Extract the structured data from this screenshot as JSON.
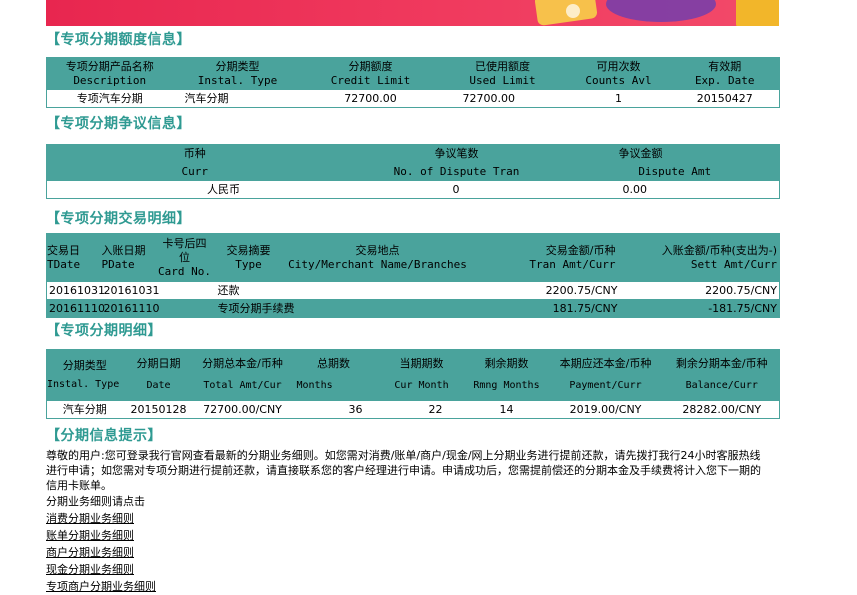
{
  "colors": {
    "teal": "#4aa39c",
    "title": "#2f9a92",
    "banner": "#e8264f"
  },
  "credit_info": {
    "title": "【专项分期额度信息】",
    "headers": [
      {
        "cn": "专项分期产品名称",
        "en": "Description"
      },
      {
        "cn": "分期类型",
        "en": "Instal. Type"
      },
      {
        "cn": "分期额度",
        "en": "Credit Limit"
      },
      {
        "cn": "已使用额度",
        "en": "Used Limit"
      },
      {
        "cn": "可用次数",
        "en": "Counts Avl"
      },
      {
        "cn": "有效期",
        "en": "Exp. Date"
      }
    ],
    "rows": [
      [
        "专项汽车分期",
        "汽车分期",
        "72700.00",
        "72700.00",
        "1",
        "20150427"
      ]
    ]
  },
  "dispute_info": {
    "title": "【专项分期争议信息】",
    "headers": [
      {
        "cn": "币种",
        "en": "Curr"
      },
      {
        "cn": "争议笔数",
        "en": "No. of Dispute Tran"
      },
      {
        "cn": "争议金额",
        "en": "Dispute Amt"
      }
    ],
    "rows": [
      [
        "人民币",
        "0",
        "0.00"
      ]
    ]
  },
  "transactions": {
    "title": "【专项分期交易明细】",
    "headers": [
      {
        "cn": "交易日",
        "en": "TDate"
      },
      {
        "cn": "入账日期",
        "en": "PDate"
      },
      {
        "cn": "卡号后四位",
        "en": "Card No."
      },
      {
        "cn": "交易摘要",
        "en": "Type"
      },
      {
        "cn": "交易地点",
        "en": "City/Merchant Name/Branches"
      },
      {
        "cn": "交易金额/币种",
        "en": "Tran Amt/Curr"
      },
      {
        "cn": "入账金额/币种(支出为-)",
        "en": "Sett Amt/Curr"
      }
    ],
    "rows": [
      [
        "20161031",
        "20161031",
        "",
        "还款",
        "",
        "2200.75/CNY",
        "2200.75/CNY"
      ],
      [
        "20161110",
        "20161110",
        "",
        "专项分期手续费",
        "",
        "181.75/CNY",
        "-181.75/CNY"
      ]
    ]
  },
  "installments": {
    "title": "【专项分期明细】",
    "headers": [
      {
        "cn": "分期类型",
        "en": "Instal. Type"
      },
      {
        "cn": "分期日期",
        "en": "Date"
      },
      {
        "cn": "分期总本金/币种",
        "en": "Total Amt/Cur"
      },
      {
        "cn": "总期数",
        "en": "Months"
      },
      {
        "cn": "当期期数",
        "en": "Cur Month"
      },
      {
        "cn": "剩余期数",
        "en": "Rmng Months"
      },
      {
        "cn": "本期应还本金/币种",
        "en": "Payment/Curr"
      },
      {
        "cn": "剩余分期本金/币种",
        "en": "Balance/Curr"
      }
    ],
    "rows": [
      [
        "汽车分期",
        "20150128",
        "72700.00/CNY",
        "36",
        "22",
        "14",
        "2019.00/CNY",
        "28282.00/CNY"
      ]
    ]
  },
  "notice": {
    "title": "【分期信息提示】",
    "text": "尊敬的用户:您可登录我行官网查看最新的分期业务细则。如您需对消费/账单/商户/现金/网上分期业务进行提前还款，请先拨打我行24小时客服热线进行申请；如您需对专项分期进行提前还款，请直接联系您的客户经理进行申请。申请成功后，您需提前偿还的分期本金及手续费将计入您下一期的信用卡账单。",
    "link_heading": "分期业务细则请点击",
    "links": [
      "消费分期业务细则",
      "账单分期业务细则",
      "商户分期业务细则",
      "现金分期业务细则",
      "专项商户分期业务细则"
    ]
  }
}
